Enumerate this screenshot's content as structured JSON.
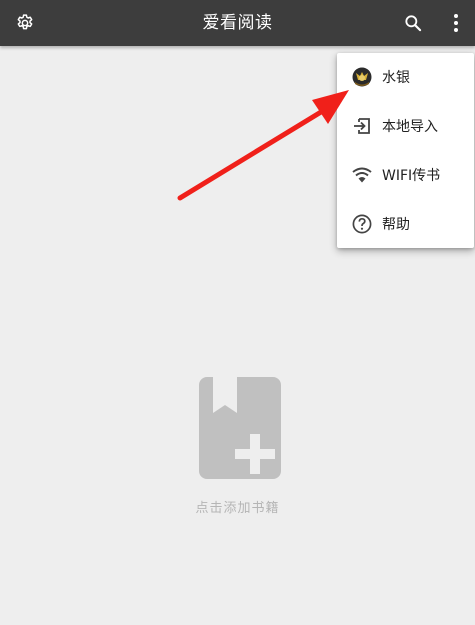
{
  "appbar": {
    "title": "爱看阅读",
    "settings_icon": "gear-icon",
    "search_icon": "search-icon",
    "more_icon": "more-vertical-icon",
    "background": "#3d3d3d"
  },
  "empty_state": {
    "icon": "book-add-icon",
    "hint": "点击添加书籍",
    "icon_color": "#c0c0c0"
  },
  "menu": {
    "items": [
      {
        "label": "水银",
        "icon": "avatar-icon"
      },
      {
        "label": "本地导入",
        "icon": "import-icon"
      },
      {
        "label": "WIFI传书",
        "icon": "wifi-icon"
      },
      {
        "label": "帮助",
        "icon": "help-icon"
      }
    ]
  },
  "annotation": {
    "icon": "red-arrow-icon",
    "color": "#f0201a"
  }
}
